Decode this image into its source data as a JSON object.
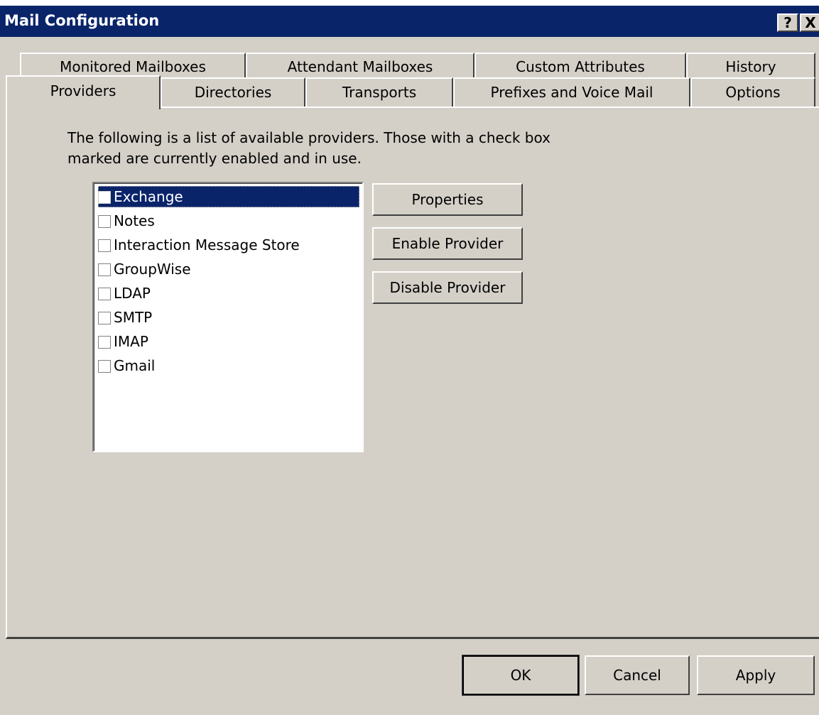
{
  "window": {
    "title": "Mail Configuration",
    "help_button": "?",
    "close_button": "X"
  },
  "tabs": {
    "row1": [
      "Monitored Mailboxes",
      "Attendant Mailboxes",
      "Custom Attributes",
      "History"
    ],
    "row2": [
      "Providers",
      "Directories",
      "Transports",
      "Prefixes and Voice Mail",
      "Options"
    ],
    "active": "Providers"
  },
  "providers_tab": {
    "description": "The following is a list of available providers. Those with a check box marked are currently enabled and in use.",
    "providers": [
      {
        "name": "Exchange",
        "checked": false,
        "selected": true
      },
      {
        "name": "Notes",
        "checked": false,
        "selected": false
      },
      {
        "name": "Interaction Message Store",
        "checked": false,
        "selected": false
      },
      {
        "name": "GroupWise",
        "checked": false,
        "selected": false
      },
      {
        "name": "LDAP",
        "checked": false,
        "selected": false
      },
      {
        "name": "SMTP",
        "checked": false,
        "selected": false
      },
      {
        "name": "IMAP",
        "checked": false,
        "selected": false
      },
      {
        "name": "Gmail",
        "checked": false,
        "selected": false
      }
    ],
    "properties_label": "Properties",
    "enable_label": "Enable Provider",
    "disable_label": "Disable Provider"
  },
  "footer": {
    "ok_label": "OK",
    "cancel_label": "Cancel",
    "apply_label": "Apply"
  },
  "colors": {
    "titlebar": "#0a246a",
    "face": "#d4d0c8",
    "selection": "#0a246a"
  }
}
